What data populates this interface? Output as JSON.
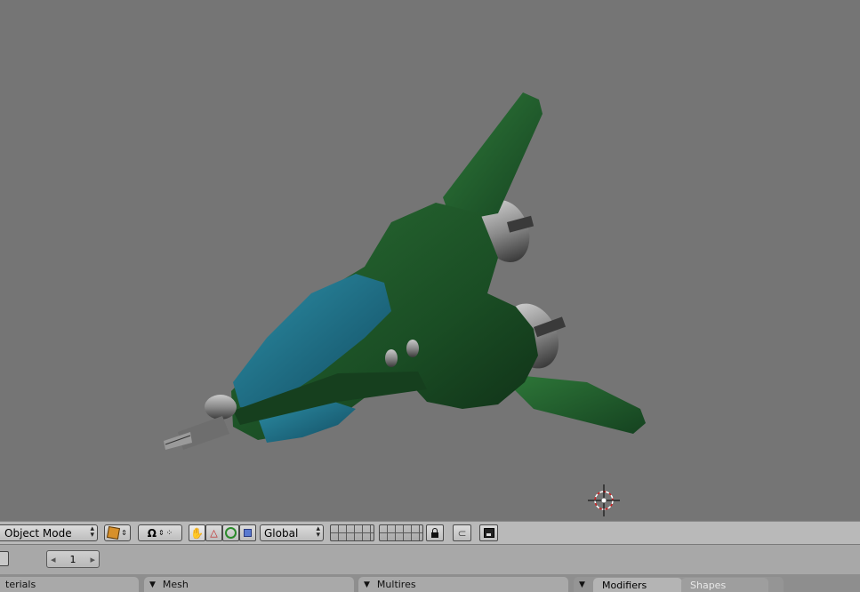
{
  "header": {
    "mode_label": "Object Mode",
    "orientation_label": "Global"
  },
  "timeline": {
    "current_frame": "1",
    "prev_arrow": "◂",
    "next_arrow": "▸"
  },
  "panels": [
    {
      "label": "terials"
    },
    {
      "label": "Mesh"
    },
    {
      "label": "Multires"
    }
  ],
  "tabs": {
    "active": "Modifiers",
    "inactive": "Shapes"
  },
  "icons": {
    "collapse": "▼",
    "lock": "lock-icon"
  },
  "colors": {
    "viewport_bg": "#757575",
    "hull_green": "#1f5a2a",
    "cockpit_teal": "#1d6f86",
    "header_bg": "#b9b9b9"
  }
}
